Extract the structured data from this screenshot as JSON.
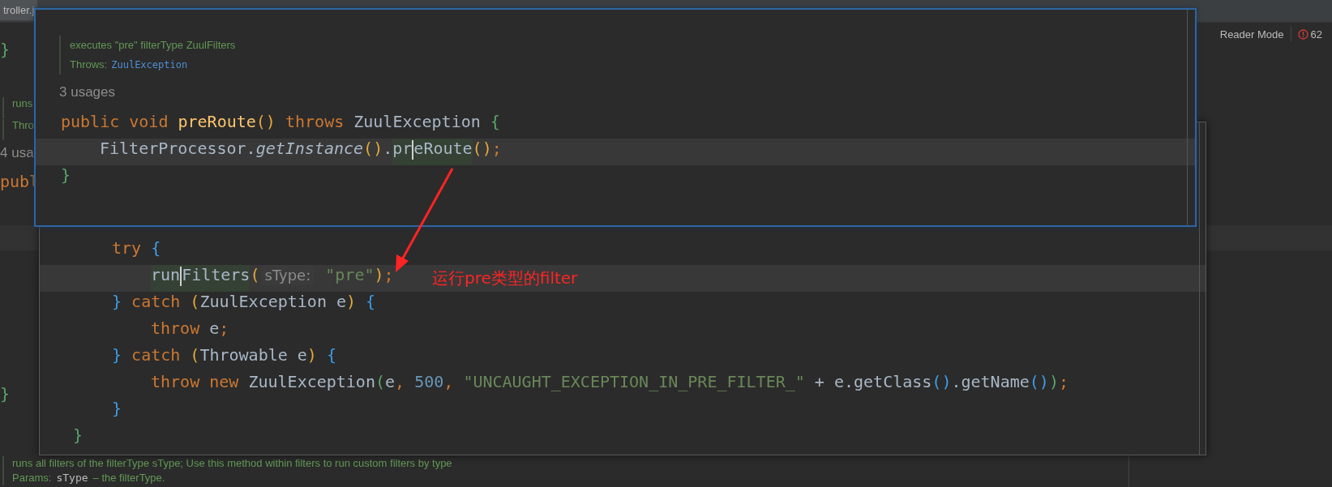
{
  "tab": {
    "label": "troller.j"
  },
  "toolbar": {
    "reader_mode": "Reader Mode",
    "problems_count": "62"
  },
  "background_lines": [
    {
      "kind": "code",
      "tokens": [
        {
          "text": "}",
          "kind": "bracket_green"
        }
      ]
    },
    {
      "kind": "doc",
      "text": "runs"
    },
    {
      "kind": "doc",
      "text": "Thro"
    },
    {
      "kind": "usages",
      "text": "4 usa"
    },
    {
      "kind": "code",
      "tokens": [
        {
          "text": "publ",
          "kind": "kw"
        }
      ]
    },
    {
      "kind": "code",
      "tokens": [
        {
          "text": "}",
          "kind": "bracket_green"
        }
      ]
    }
  ],
  "background_doc": {
    "summary": "runs all filters of the filterType sType; Use this method within filters to run custom filters by type",
    "params_label": "Params:",
    "param_name": "sType",
    "param_desc": "– the filterType."
  },
  "popup_back": {
    "lines": [
      {
        "current": false,
        "tokens": [
          {
            "text": "try ",
            "kind": "kw"
          },
          {
            "text": "{",
            "kind": "bracket_blue"
          }
        ],
        "children": [
          {
            "current": true,
            "tokens": [
              {
                "kind": "usage",
                "parts": [
                  {
                    "text": "run",
                    "kind": "plain"
                  },
                  {
                    "kind": "caret"
                  },
                  {
                    "text": "Filters",
                    "kind": "plain"
                  }
                ]
              },
              {
                "text": "(",
                "kind": "bracket_yellow"
              },
              {
                "text": "sType:",
                "kind": "hint"
              },
              {
                "text": "\"pre\"",
                "kind": "string"
              },
              {
                "text": ")",
                "kind": "bracket_yellow"
              },
              {
                "text": ";",
                "kind": "punct"
              }
            ]
          }
        ]
      },
      {
        "current": false,
        "tokens": [
          {
            "text": "}",
            "kind": "bracket_blue"
          },
          {
            "text": " catch ",
            "kind": "kw"
          },
          {
            "text": "(",
            "kind": "bracket_yellow"
          },
          {
            "text": "ZuulException e",
            "kind": "plain"
          },
          {
            "text": ")",
            "kind": "bracket_yellow"
          },
          {
            "text": " {",
            "kind": "bracket_blue"
          }
        ],
        "children": [
          {
            "current": false,
            "tokens": [
              {
                "text": "throw ",
                "kind": "kw"
              },
              {
                "text": "e",
                "kind": "plain"
              },
              {
                "text": ";",
                "kind": "punct"
              }
            ]
          }
        ]
      },
      {
        "current": false,
        "tokens": [
          {
            "text": "}",
            "kind": "bracket_blue"
          },
          {
            "text": " catch ",
            "kind": "kw"
          },
          {
            "text": "(",
            "kind": "bracket_yellow"
          },
          {
            "text": "Throwable e",
            "kind": "plain"
          },
          {
            "text": ")",
            "kind": "bracket_yellow"
          },
          {
            "text": " {",
            "kind": "bracket_blue"
          }
        ],
        "children": [
          {
            "current": false,
            "tokens": [
              {
                "text": "throw new ",
                "kind": "kw"
              },
              {
                "text": "ZuulException",
                "kind": "plain"
              },
              {
                "text": "(",
                "kind": "bracket_green"
              },
              {
                "text": "e",
                "kind": "plain"
              },
              {
                "text": ", ",
                "kind": "punct"
              },
              {
                "text": "500",
                "kind": "number"
              },
              {
                "text": ", ",
                "kind": "punct"
              },
              {
                "text": "\"UNCAUGHT_EXCEPTION_IN_PRE_FILTER_\"",
                "kind": "string"
              },
              {
                "text": " + e.getClass",
                "kind": "plain"
              },
              {
                "text": "()",
                "kind": "bracket_blue"
              },
              {
                "text": ".getName",
                "kind": "plain"
              },
              {
                "text": "()",
                "kind": "bracket_blue"
              },
              {
                "text": ")",
                "kind": "bracket_green"
              },
              {
                "text": ";",
                "kind": "punct"
              }
            ]
          }
        ]
      },
      {
        "current": false,
        "tokens": [
          {
            "text": "}",
            "kind": "bracket_blue"
          }
        ]
      }
    ],
    "closing_line": {
      "current": false,
      "tokens": [
        {
          "text": "}",
          "kind": "bracket_green"
        }
      ]
    }
  },
  "popup_front": {
    "doc": {
      "summary": "executes \"pre\" filterType ZuulFilters",
      "throws_label": "Throws:",
      "throws_type": "ZuulException"
    },
    "usages": "3 usages",
    "lines": [
      {
        "current": false,
        "tokens": [
          {
            "text": "public void ",
            "kind": "kw"
          },
          {
            "text": "preRoute",
            "kind": "decl"
          },
          {
            "text": "()",
            "kind": "bracket_yellow"
          },
          {
            "text": " throws ",
            "kind": "kw"
          },
          {
            "text": "ZuulException ",
            "kind": "plain"
          },
          {
            "text": "{",
            "kind": "bracket_green"
          }
        ],
        "children": [
          {
            "current": true,
            "tokens": [
              {
                "text": "FilterProcessor.",
                "kind": "plain"
              },
              {
                "text": "getInstance",
                "kind": "italic"
              },
              {
                "text": "()",
                "kind": "bracket_yellow"
              },
              {
                "text": ".",
                "kind": "plain"
              },
              {
                "kind": "usage",
                "parts": [
                  {
                    "text": "pr",
                    "kind": "plain"
                  },
                  {
                    "kind": "caret"
                  },
                  {
                    "text": "eRoute",
                    "kind": "plain"
                  }
                ]
              },
              {
                "text": "()",
                "kind": "bracket_yellow"
              },
              {
                "text": ";",
                "kind": "punct"
              }
            ]
          }
        ]
      },
      {
        "current": false,
        "tokens": [
          {
            "text": "}",
            "kind": "bracket_green"
          }
        ]
      }
    ]
  },
  "annotation": {
    "text": "运行pre类型的filter"
  }
}
